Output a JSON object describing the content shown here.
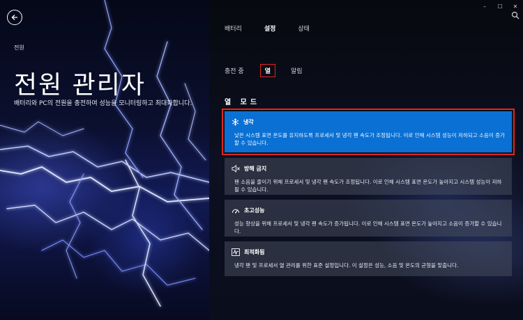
{
  "left": {
    "breadcrumb": "전원",
    "title": "전원 관리자",
    "description": "배터리와 PC의 전원을 충전하여 성능을 모니터링하고 최대화합니다."
  },
  "window_controls": {
    "minimize": "–",
    "maximize": "☐",
    "close": "✕"
  },
  "tabs": [
    {
      "label": "배터리",
      "active": false
    },
    {
      "label": "설정",
      "active": true
    },
    {
      "label": "상태",
      "active": false
    }
  ],
  "subtabs": [
    {
      "label": "충전 중",
      "active": false
    },
    {
      "label": "열",
      "active": true
    },
    {
      "label": "알림",
      "active": false
    }
  ],
  "section_title": "열 모드",
  "modes": [
    {
      "icon": "snowflake-icon",
      "name": "냉각",
      "selected": true,
      "description": "낮은 시스템 표면 온도를 유지하도록 프로세서 및 냉각 팬 속도가 조정됩니다. 이로 인해 시스템 성능이 저하되고 소음이 증가할 수 있습니다."
    },
    {
      "icon": "mute-icon",
      "name": "방해 금지",
      "selected": false,
      "description": "팬 소음을 줄이기 위해 프로세서 및 냉각 팬 속도가 조정됩니다. 이로 인해 시스템 표면 온도가 높아지고 시스템 성능이 저하될 수 있습니다."
    },
    {
      "icon": "gauge-icon",
      "name": "초고성능",
      "selected": false,
      "description": "성능 향상을 위해 프로세서 및 냉각 팬 속도가 증가됩니다. 이로 인해 시스템 표면 온도가 높아지고 소음이 증가할 수 있습니다."
    },
    {
      "icon": "waveform-icon",
      "name": "최적화됨",
      "selected": false,
      "description": "냉각 팬 및 프로세서 열 관리를 위한 표준 설정입니다. 이 설정은 성능, 소음 및 온도의 균형을 맞춥니다."
    }
  ],
  "colors": {
    "accent": "#0a70d3",
    "highlight": "#e0261f"
  }
}
